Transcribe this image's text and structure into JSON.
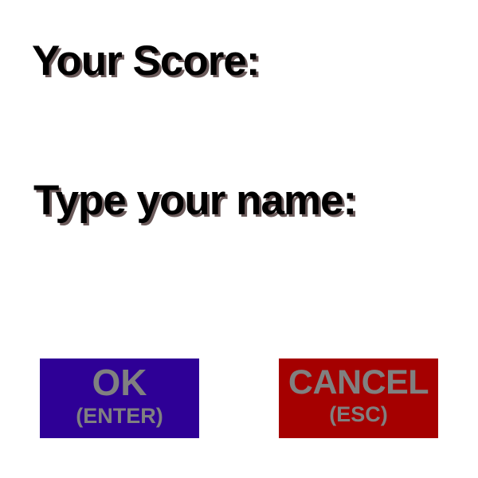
{
  "labels": {
    "score": "Your Score:",
    "name_prompt": "Type your name:"
  },
  "buttons": {
    "ok": {
      "label": "OK",
      "shortcut": "(ENTER)",
      "background": "#2e0096"
    },
    "cancel": {
      "label": "CANCEL",
      "shortcut": "(ESC)",
      "background": "#a50000"
    }
  },
  "colors": {
    "text": "#000000",
    "text_shadow": "#6b5a5a",
    "button_text": "#808080",
    "page_background": "#ffffff"
  }
}
